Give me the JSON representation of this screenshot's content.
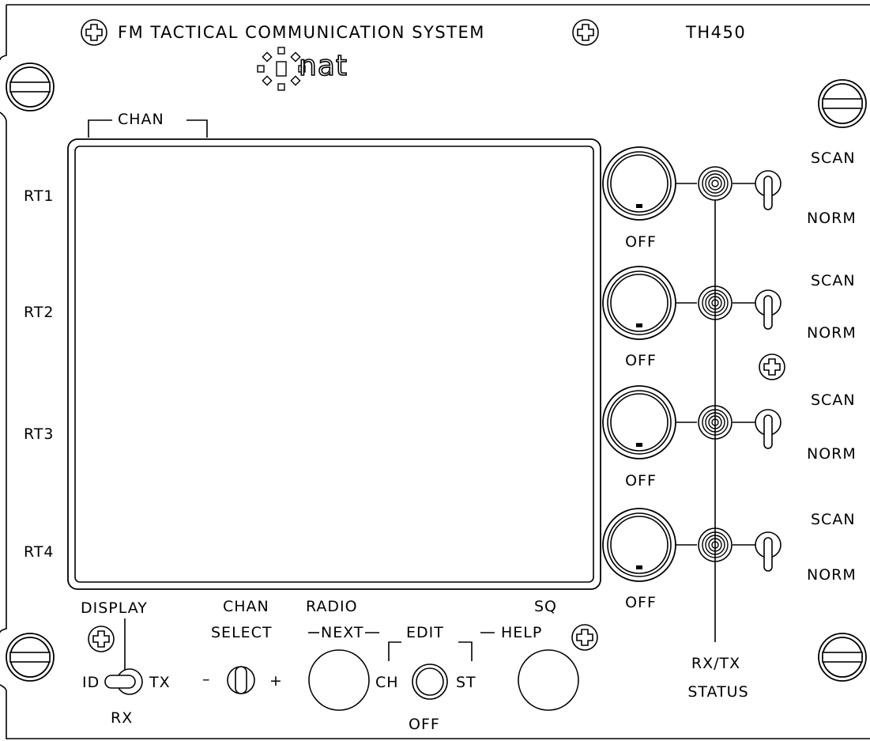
{
  "header": {
    "title": "FM TACTICAL COMMUNICATION SYSTEM",
    "model": "TH450",
    "logo": "nat"
  },
  "display": {
    "bracket_label": "CHAN",
    "row_labels": [
      "RT1",
      "RT2",
      "RT3",
      "RT4"
    ]
  },
  "radios": [
    {
      "id": "RT1",
      "knob_label": "OFF",
      "toggle_up": "SCAN",
      "toggle_down": "NORM"
    },
    {
      "id": "RT2",
      "knob_label": "OFF",
      "toggle_up": "SCAN",
      "toggle_down": "NORM"
    },
    {
      "id": "RT3",
      "knob_label": "OFF",
      "toggle_up": "SCAN",
      "toggle_down": "NORM"
    },
    {
      "id": "RT4",
      "knob_label": "OFF",
      "toggle_up": "SCAN",
      "toggle_down": "NORM"
    }
  ],
  "status": {
    "label_line1": "RX/TX",
    "label_line2": "STATUS"
  },
  "controls": {
    "display_switch": {
      "label": "DISPLAY",
      "left": "ID",
      "right": "TX",
      "bottom": "RX"
    },
    "chan_select": {
      "line1": "CHAN",
      "line2": "SELECT",
      "minus": "–",
      "plus": "+"
    },
    "radio_next": {
      "line1": "RADIO",
      "line2": "NEXT"
    },
    "edit": {
      "label": "EDIT",
      "left": "CH",
      "right": "ST",
      "bottom": "OFF"
    },
    "sq_help": {
      "line1": "SQ",
      "line2": "HELP"
    }
  }
}
